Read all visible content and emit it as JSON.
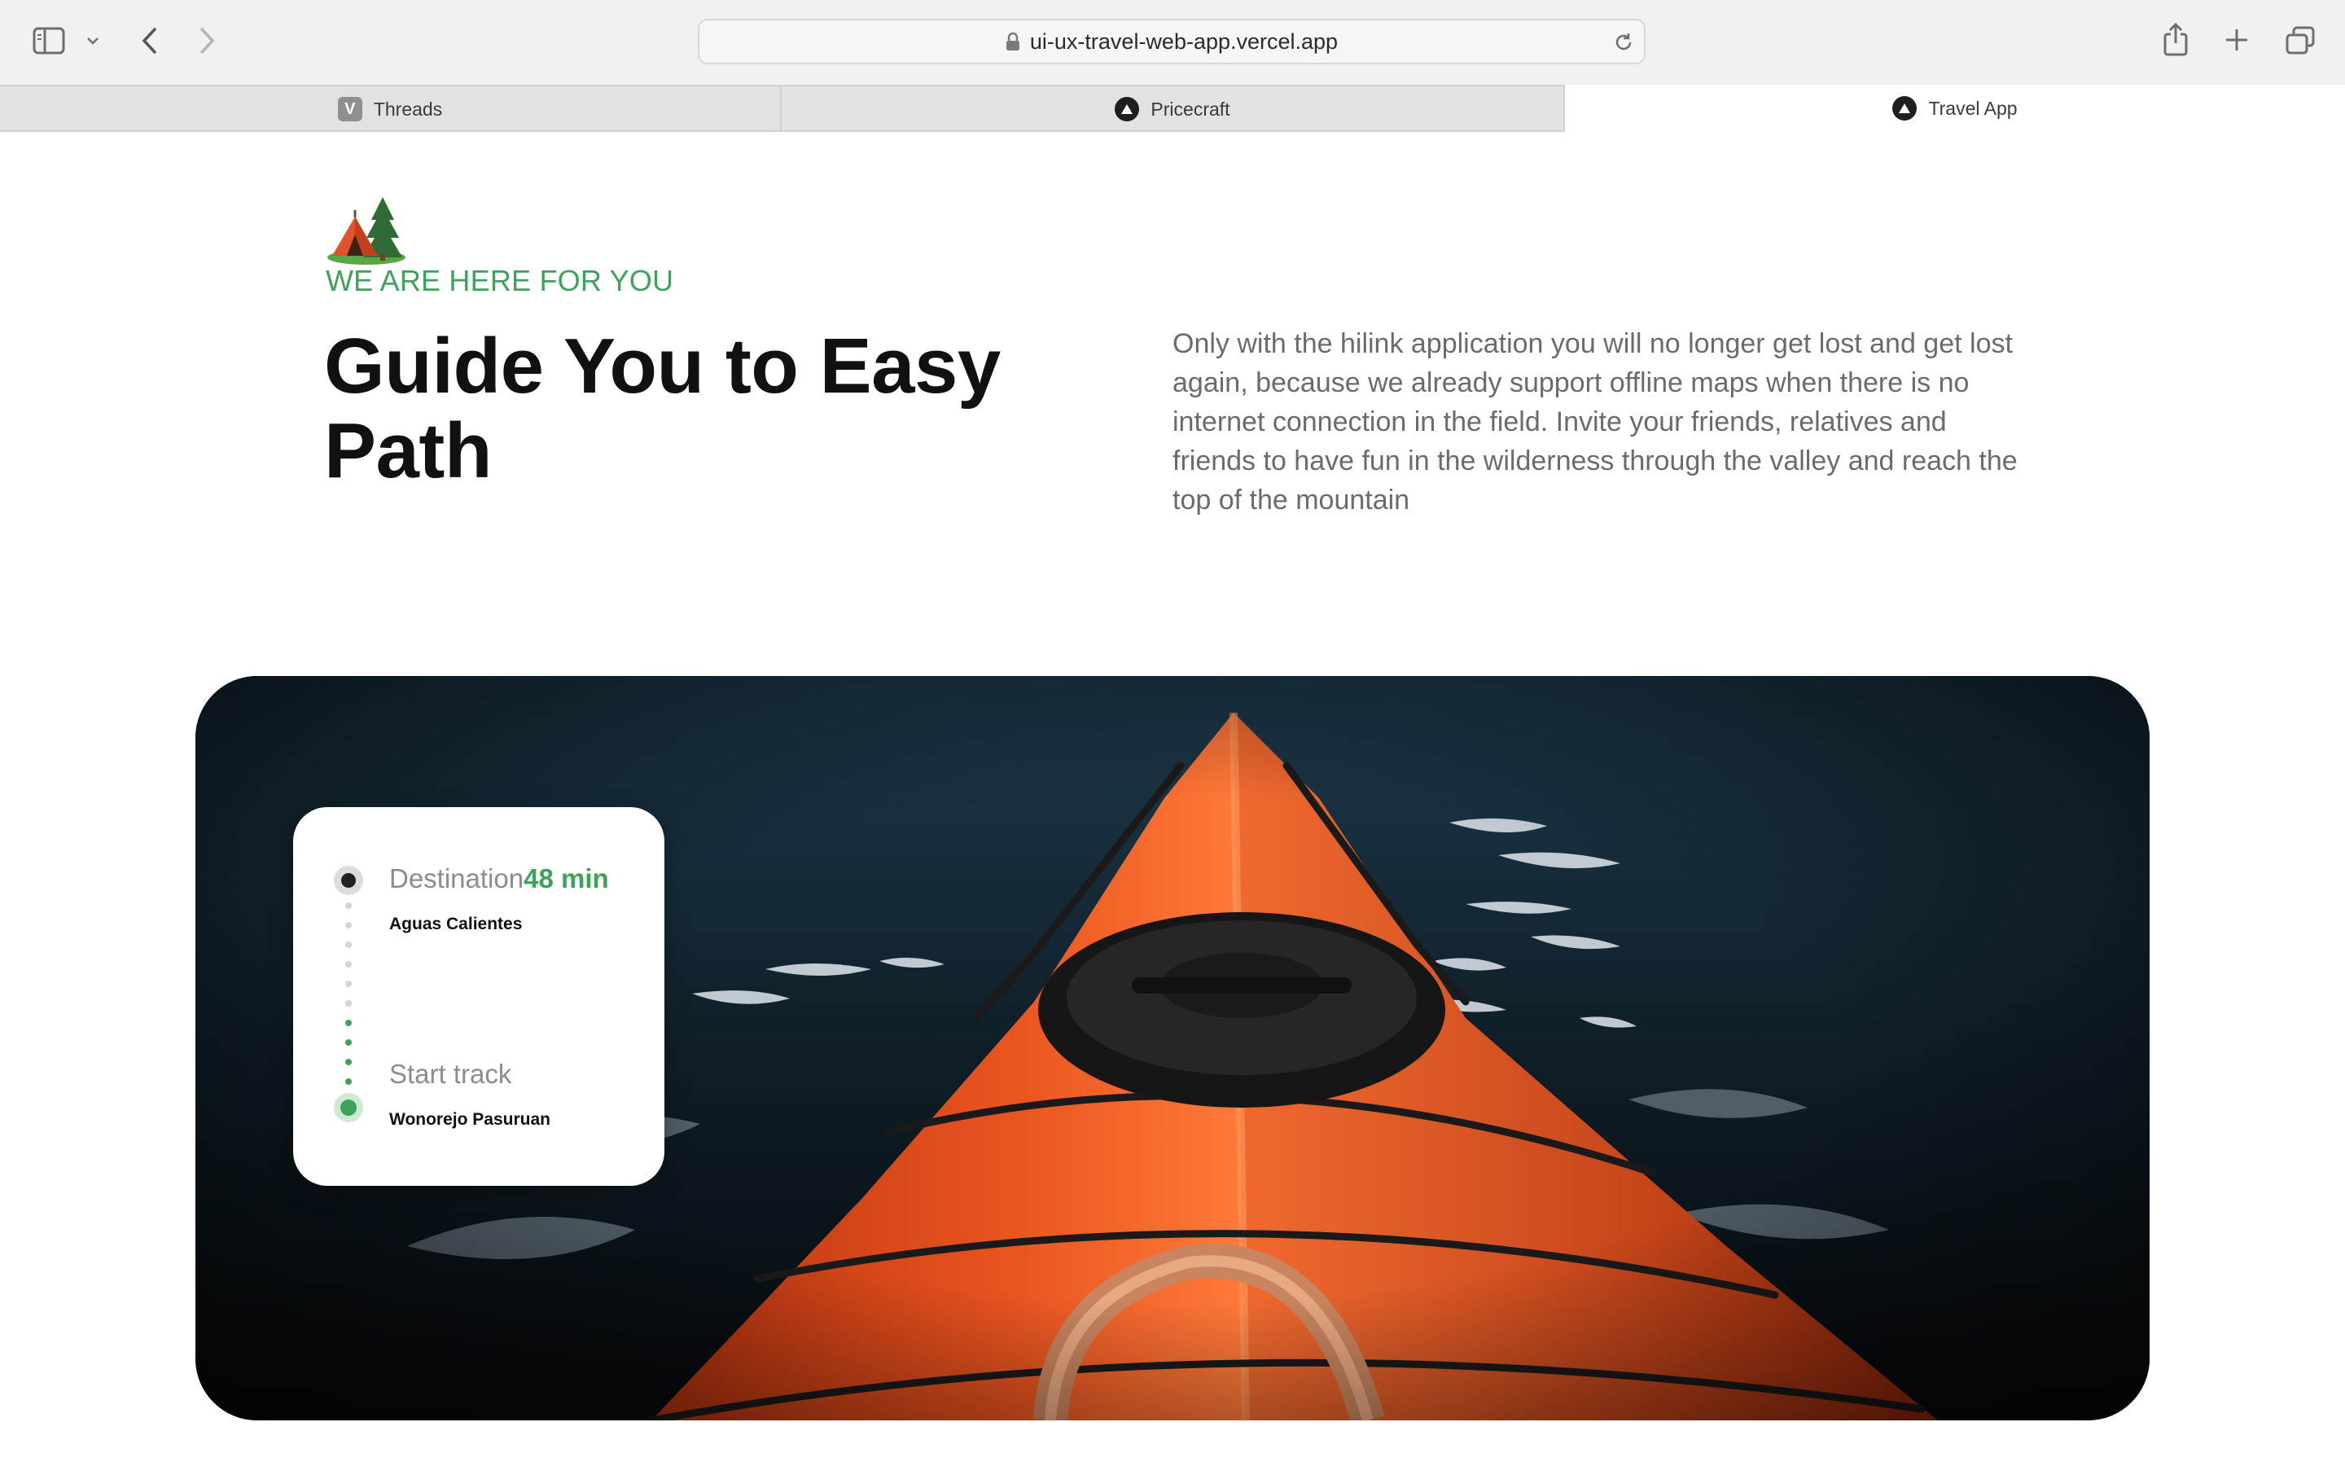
{
  "browser": {
    "url": "ui-ux-travel-web-app.vercel.app",
    "tabs": [
      {
        "label": "Threads",
        "favicon": "V"
      },
      {
        "label": "Pricecraft",
        "favicon": "triangle-icon"
      },
      {
        "label": "Travel App",
        "favicon": "triangle-icon",
        "active": true
      }
    ]
  },
  "section": {
    "icon": "camping-tent-icon",
    "eyebrow": "WE ARE HERE FOR YOU",
    "headline_line1": "Guide You to Easy",
    "headline_line2": "Path",
    "description": "Only with the hilink application you will no longer get lost and get lost again, because we already support offline maps when there is no internet connection in the field. Invite your friends, relatives and friends to have fun in the wilderness through the valley and reach the top of the mountain"
  },
  "route_card": {
    "destination_label": "Destination",
    "destination_time": "48 min",
    "destination_place": "Aguas Calientes",
    "start_label": "Start track",
    "start_place": "Wonorejo Pasuruan"
  },
  "colors": {
    "accent_green": "#3da35a",
    "kayak_orange": "#e8501f"
  }
}
